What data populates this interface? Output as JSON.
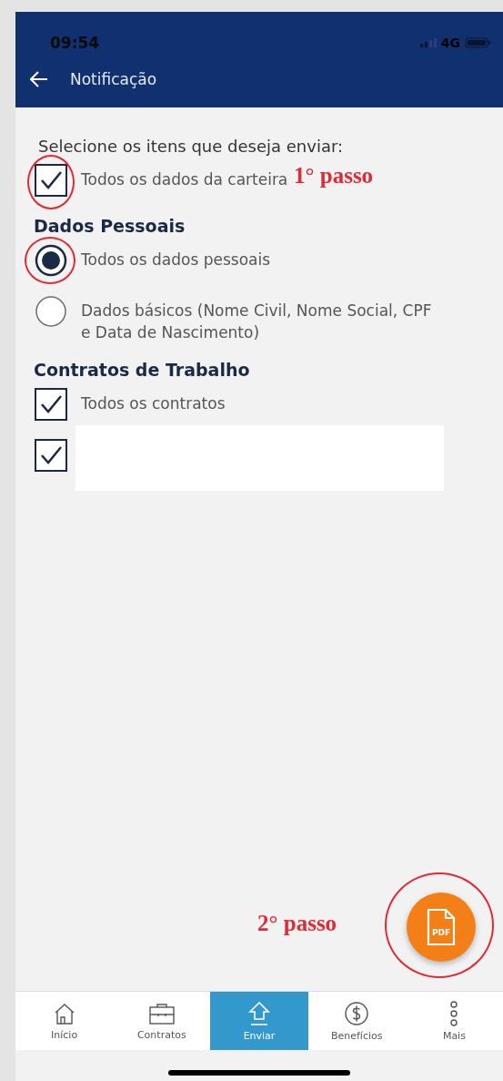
{
  "status_bar": {
    "time": "09:54",
    "network": "4G"
  },
  "header": {
    "title": "Notificação"
  },
  "prompt": "Selecione os itens que deseja enviar:",
  "all_item": {
    "label": "Todos os dados da carteira",
    "checked": true,
    "circled": true,
    "note": "1° passo"
  },
  "sections": [
    {
      "title": "Dados Pessoais",
      "options": [
        {
          "kind": "radio",
          "label": "Todos os dados pessoais",
          "selected": true,
          "circled": true
        },
        {
          "kind": "radio",
          "label": "Dados básicos (Nome Civil, Nome Social, CPF e Data de Nascimento)",
          "selected": false,
          "circled": false
        }
      ]
    },
    {
      "title": "Contratos de Trabalho",
      "options": [
        {
          "kind": "checkbox",
          "label": "Todos os contratos",
          "checked": true,
          "circled": false
        },
        {
          "kind": "checkbox",
          "checked": true,
          "circled": false
        }
      ]
    }
  ],
  "fab": {
    "label": "PDF",
    "circled": true,
    "note": "2° passo"
  },
  "nav": [
    {
      "label": "Início",
      "selected": false
    },
    {
      "label": "Contratos",
      "selected": false
    },
    {
      "label": "Enviar",
      "selected": true
    },
    {
      "label": "Benefícios",
      "selected": false
    },
    {
      "label": "Mais",
      "selected": false
    }
  ]
}
